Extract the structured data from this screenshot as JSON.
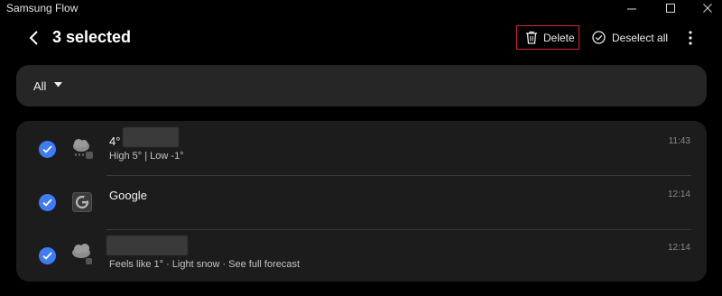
{
  "app": {
    "title": "Samsung Flow"
  },
  "window": {
    "minimize_label": "—",
    "maximize_label": "☐",
    "close_label": "✕"
  },
  "header": {
    "title": "3 selected",
    "delete_label": "Delete",
    "deselect_label": "Deselect all"
  },
  "filter": {
    "selected": "All"
  },
  "notifications": [
    {
      "title": "4°",
      "subtitle": "High 5° | Low -1°",
      "time": "11:43",
      "icon": "weather-snow-icon",
      "selected": true
    },
    {
      "title": "Google",
      "subtitle": "",
      "time": "12:14",
      "icon": "google-icon",
      "selected": true
    },
    {
      "title": "",
      "subtitle": "Feels like 1° · Light snow · See full forecast",
      "time": "12:14",
      "icon": "weather-cloud-icon",
      "selected": true
    }
  ],
  "colors": {
    "accent": "#3e7bf4",
    "delete_border": "#d9262c",
    "panel": "#262626",
    "list_bg": "#1c1c1c"
  }
}
